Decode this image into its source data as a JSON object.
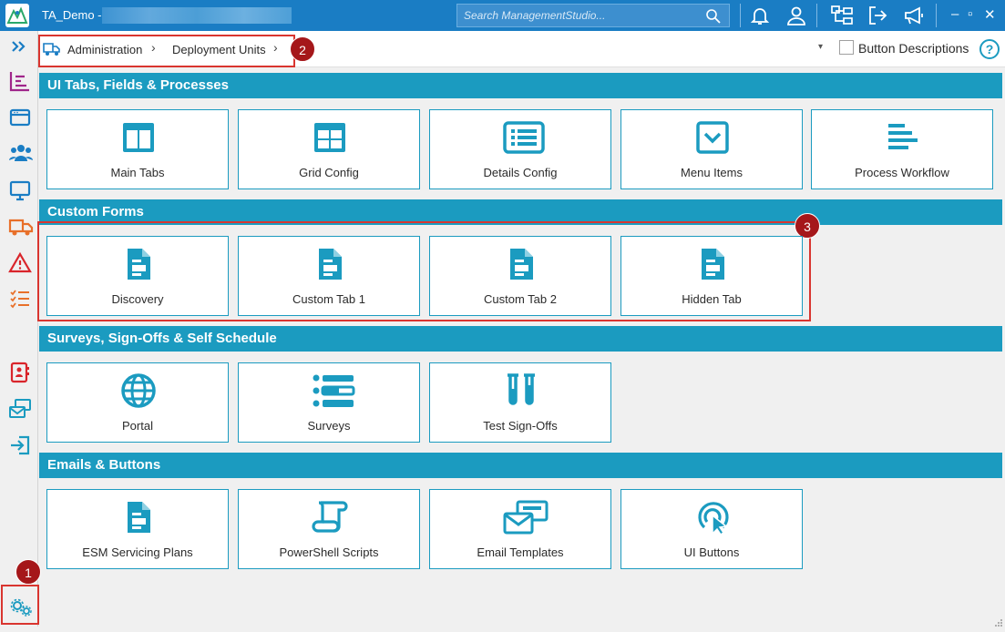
{
  "app": {
    "title": "TA_Demo -",
    "search_placeholder": "Search ManagementStudio..."
  },
  "window_controls": {
    "minimize": "–",
    "maximize": "▫",
    "close": "✕"
  },
  "breadcrumb": {
    "items": [
      "Administration",
      "Deployment Units"
    ],
    "separator": "›"
  },
  "toolbar": {
    "dropdown_arrow": "▾",
    "button_descriptions_label": "Button Descriptions",
    "help_label": "?"
  },
  "badges": {
    "one": "1",
    "two": "2",
    "three": "3"
  },
  "sections": [
    {
      "title": "UI Tabs, Fields & Processes",
      "tiles": [
        {
          "label": "Main Tabs",
          "icon": "main-tabs-icon"
        },
        {
          "label": "Grid Config",
          "icon": "grid-config-icon"
        },
        {
          "label": "Details Config",
          "icon": "details-config-icon"
        },
        {
          "label": "Menu Items",
          "icon": "menu-items-icon"
        },
        {
          "label": "Process Workflow",
          "icon": "process-workflow-icon"
        }
      ]
    },
    {
      "title": "Custom Forms",
      "tiles": [
        {
          "label": "Discovery",
          "icon": "form-document-icon"
        },
        {
          "label": "Custom Tab 1",
          "icon": "form-document-icon"
        },
        {
          "label": "Custom Tab 2",
          "icon": "form-document-icon"
        },
        {
          "label": "Hidden Tab",
          "icon": "form-document-icon"
        }
      ]
    },
    {
      "title": "Surveys, Sign-Offs & Self Schedule",
      "tiles": [
        {
          "label": "Portal",
          "icon": "globe-icon"
        },
        {
          "label": "Surveys",
          "icon": "survey-list-icon"
        },
        {
          "label": "Test Sign-Offs",
          "icon": "test-tubes-icon"
        }
      ]
    },
    {
      "title": "Emails & Buttons",
      "tiles": [
        {
          "label": "ESM Servicing Plans",
          "icon": "form-document-icon"
        },
        {
          "label": "PowerShell Scripts",
          "icon": "script-scroll-icon"
        },
        {
          "label": "Email Templates",
          "icon": "email-templates-icon"
        },
        {
          "label": "UI Buttons",
          "icon": "ui-button-click-icon"
        }
      ]
    }
  ],
  "colors": {
    "title_bar": "#1a7dc4",
    "section_header": "#1b9bc0",
    "highlight": "#d9352f",
    "badge": "#a5171a"
  }
}
